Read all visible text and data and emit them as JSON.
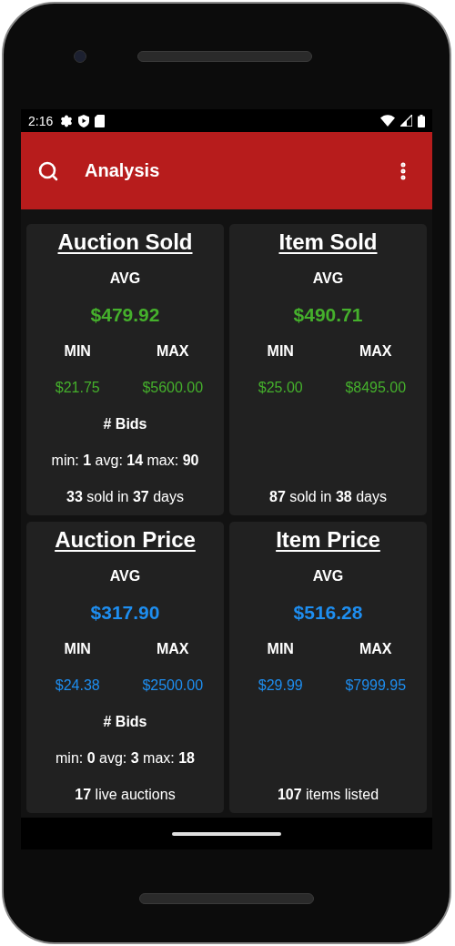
{
  "status_bar": {
    "time": "2:16"
  },
  "app_bar": {
    "title": "Analysis"
  },
  "cards": [
    {
      "title": "Auction Sold",
      "avg_label": "AVG",
      "avg": "$479.92",
      "min_label": "MIN",
      "max_label": "MAX",
      "min": "$21.75",
      "max": "$5600.00",
      "color": "#45b02c",
      "bids_label": "# Bids",
      "bids": "min: **1** avg: **14** max: **90**",
      "footer": "**33** sold in **37** days"
    },
    {
      "title": "Item Sold",
      "avg_label": "AVG",
      "avg": "$490.71",
      "min_label": "MIN",
      "max_label": "MAX",
      "min": "$25.00",
      "max": "$8495.00",
      "color": "#45b02c",
      "footer": "**87** sold in **38** days"
    },
    {
      "title": "Auction Price",
      "avg_label": "AVG",
      "avg": "$317.90",
      "min_label": "MIN",
      "max_label": "MAX",
      "min": "$24.38",
      "max": "$2500.00",
      "color": "#1e8ef0",
      "bids_label": "# Bids",
      "bids": "min: **0** avg: **3** max: **18**",
      "footer": "**17** live auctions"
    },
    {
      "title": "Item Price",
      "avg_label": "AVG",
      "avg": "$516.28",
      "min_label": "MIN",
      "max_label": "MAX",
      "min": "$29.99",
      "max": "$7999.95",
      "color": "#1e8ef0",
      "footer": "**107** items listed"
    }
  ]
}
